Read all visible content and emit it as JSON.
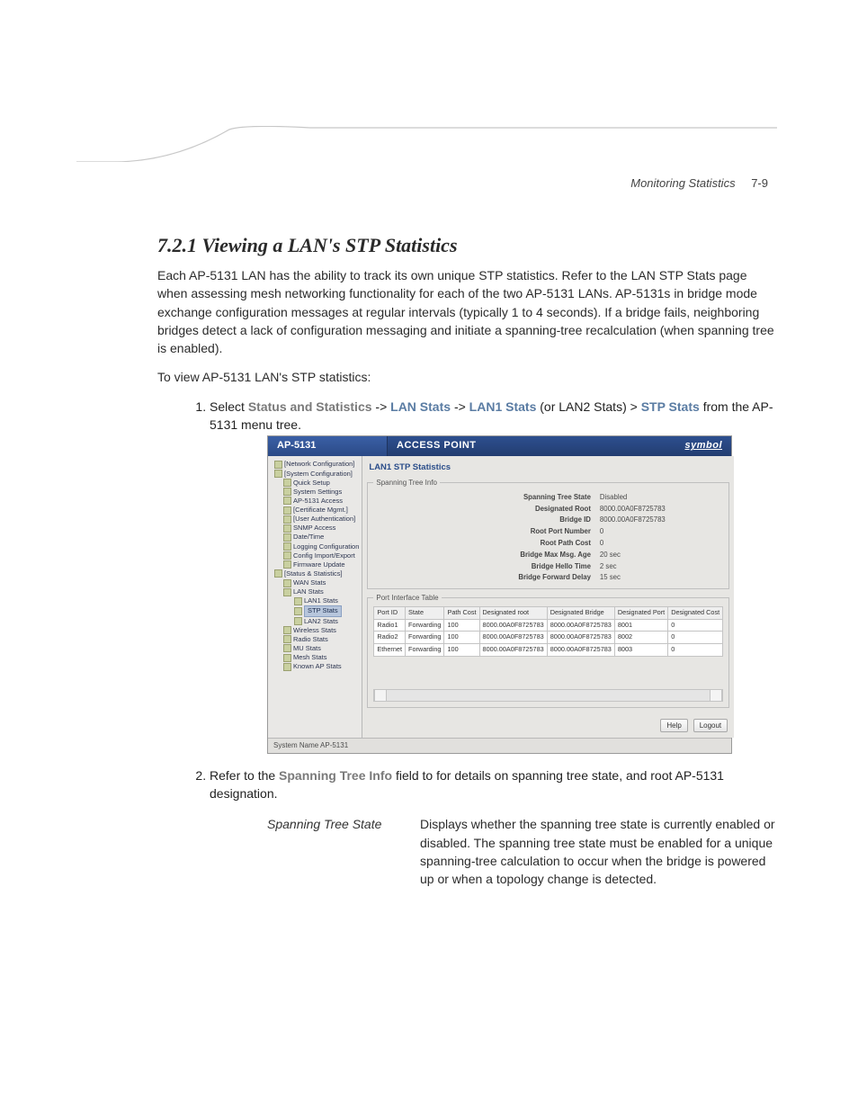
{
  "header": {
    "section": "Monitoring Statistics",
    "page": "7-9"
  },
  "title": "7.2.1 Viewing a LAN's STP Statistics",
  "para1": "Each AP-5131 LAN has the ability to track its own unique STP statistics. Refer to the LAN STP Stats page when assessing mesh networking functionality for each of the two AP-5131 LANs. AP-5131s in bridge mode exchange configuration messages at regular intervals (typically 1 to 4 seconds). If a bridge fails, neighboring bridges detect a lack of configuration messaging and initiate a spanning-tree recalculation (when spanning tree is enabled).",
  "para2": "To view AP-5131 LAN's STP statistics:",
  "step1": {
    "lead": "Select ",
    "p1": "Status and Statistics",
    "a1": " -> ",
    "p2": "LAN Stats",
    "a2": " -> ",
    "p3": "LAN1 Stats",
    "mid": " (or LAN2 Stats) > ",
    "p4": "STP Stats",
    "tail": " from the AP-5131 menu tree."
  },
  "step2": {
    "lead": "Refer to the ",
    "p1": "Spanning Tree Info",
    "tail": " field to for details on spanning tree state, and root AP-5131 designation."
  },
  "def": {
    "term": "Spanning Tree State",
    "desc": "Displays whether the spanning tree state is currently enabled or disabled. The spanning tree state must be enabled for a unique spanning-tree calculation to occur when the bridge is powered up or when a topology change is detected."
  },
  "shot": {
    "titlebar": {
      "left": "AP-5131",
      "mid": "ACCESS POINT",
      "brand": "symbol"
    },
    "tree": [
      {
        "lvl": 1,
        "t": "[Network Configuration]"
      },
      {
        "lvl": 1,
        "t": "[System Configuration]"
      },
      {
        "lvl": 2,
        "t": "Quick Setup"
      },
      {
        "lvl": 2,
        "t": "System Settings"
      },
      {
        "lvl": 2,
        "t": "AP-5131 Access"
      },
      {
        "lvl": 2,
        "t": "[Certificate Mgmt.]"
      },
      {
        "lvl": 2,
        "t": "[User Authentication]"
      },
      {
        "lvl": 2,
        "t": "SNMP Access"
      },
      {
        "lvl": 2,
        "t": "Date/Time"
      },
      {
        "lvl": 2,
        "t": "Logging Configuration"
      },
      {
        "lvl": 2,
        "t": "Config Import/Export"
      },
      {
        "lvl": 2,
        "t": "Firmware Update"
      },
      {
        "lvl": 1,
        "t": "[Status & Statistics]"
      },
      {
        "lvl": 2,
        "t": "WAN Stats"
      },
      {
        "lvl": 2,
        "t": "LAN Stats"
      },
      {
        "lvl": 3,
        "t": "LAN1 Stats"
      },
      {
        "lvl": 3,
        "t": "STP Stats",
        "sel": true
      },
      {
        "lvl": 3,
        "t": "LAN2 Stats"
      },
      {
        "lvl": 2,
        "t": "Wireless Stats"
      },
      {
        "lvl": 2,
        "t": "Radio Stats"
      },
      {
        "lvl": 2,
        "t": "MU Stats"
      },
      {
        "lvl": 2,
        "t": "Mesh Stats"
      },
      {
        "lvl": 2,
        "t": "Known AP Stats"
      }
    ],
    "panel_title": "LAN1 STP Statistics",
    "stinfo_legend": "Spanning Tree Info",
    "stinfo": [
      {
        "k": "Spanning Tree State",
        "v": "Disabled"
      },
      {
        "k": "Designated Root",
        "v": "8000.00A0F8725783"
      },
      {
        "k": "Bridge ID",
        "v": "8000.00A0F8725783"
      },
      {
        "k": "Root Port Number",
        "v": "0"
      },
      {
        "k": "Root Path Cost",
        "v": "0"
      },
      {
        "k": "Bridge Max Msg. Age",
        "v": "20  sec"
      },
      {
        "k": "Bridge Hello Time",
        "v": "2  sec"
      },
      {
        "k": "Bridge Forward Delay",
        "v": "15  sec"
      }
    ],
    "porttable_legend": "Port Interface Table",
    "port_headers": [
      "Port ID",
      "State",
      "Path Cost",
      "Designated root",
      "Designated Bridge",
      "Designated Port",
      "Designated Cost"
    ],
    "port_rows": [
      [
        "Radio1",
        "Forwarding",
        "100",
        "8000.00A0F8725783",
        "8000.00A0F8725783",
        "8001",
        "0"
      ],
      [
        "Radio2",
        "Forwarding",
        "100",
        "8000.00A0F8725783",
        "8000.00A0F8725783",
        "8002",
        "0"
      ],
      [
        "Ethernet",
        "Forwarding",
        "100",
        "8000.00A0F8725783",
        "8000.00A0F8725783",
        "8003",
        "0"
      ]
    ],
    "buttons": {
      "help": "Help",
      "logout": "Logout"
    },
    "statusbar": "System Name AP-5131"
  }
}
